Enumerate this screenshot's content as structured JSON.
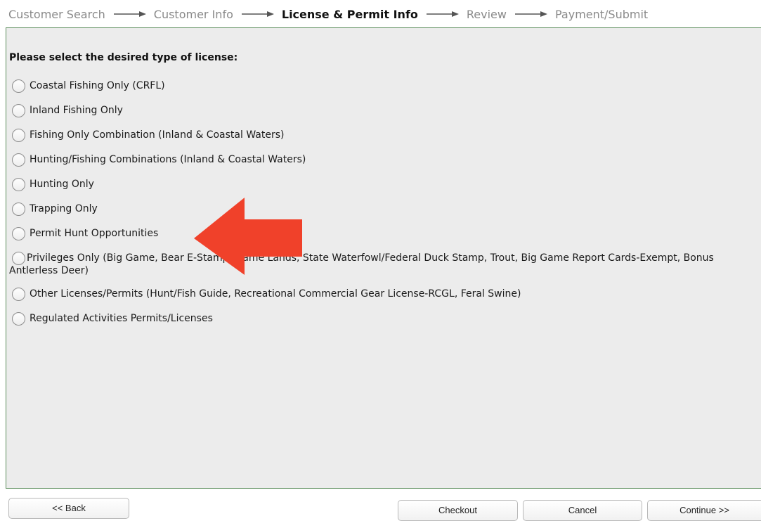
{
  "steps": [
    {
      "label": "Customer Search",
      "active": false
    },
    {
      "label": "Customer Info",
      "active": false
    },
    {
      "label": "License & Permit Info",
      "active": true
    },
    {
      "label": "Review",
      "active": false
    },
    {
      "label": "Payment/Submit",
      "active": false
    }
  ],
  "form": {
    "prompt": "Please select the desired type of license:",
    "selected": null,
    "options": [
      {
        "label": "Coastal Fishing Only (CRFL)"
      },
      {
        "label": "Inland Fishing Only"
      },
      {
        "label": "Fishing Only Combination (Inland & Coastal Waters)"
      },
      {
        "label": "Hunting/Fishing Combinations (Inland & Coastal Waters)"
      },
      {
        "label": "Hunting Only"
      },
      {
        "label": "Trapping Only"
      },
      {
        "label": "Permit Hunt Opportunities"
      },
      {
        "label": "Privileges Only (Big Game, Bear E-Stamp, Game Lands, State Waterfowl/Federal Duck Stamp, Trout, Big Game Report Cards-Exempt, Bonus Antlerless Deer)"
      },
      {
        "label": "Other Licenses/Permits (Hunt/Fish Guide, Recreational Commercial Gear License-RCGL, Feral Swine)"
      },
      {
        "label": "Regulated Activities Permits/Licenses"
      }
    ]
  },
  "annotation": {
    "icon": "red-arrow-left",
    "color": "#f0412a"
  },
  "buttons": {
    "back": "<< Back",
    "checkout": "Checkout",
    "cancel": "Cancel",
    "continue": "Continue >>"
  },
  "colors": {
    "panel_bg": "#ececec",
    "panel_border": "#5d8f5d",
    "step_inactive": "#8a8a8a",
    "step_active": "#111111"
  }
}
